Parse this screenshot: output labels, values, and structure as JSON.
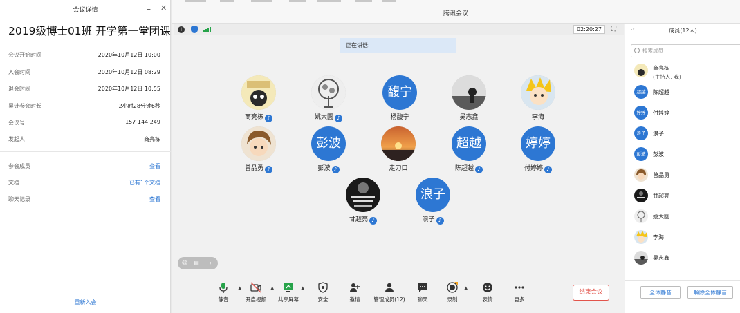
{
  "details": {
    "window_title": "会议详情",
    "meeting_title": "2019级博士01班 开学第一堂团课",
    "rows": [
      {
        "label": "会议开始时间",
        "value": "2020年10月12日 10:00"
      },
      {
        "label": "入会时间",
        "value": "2020年10月12日 08:29"
      },
      {
        "label": "退会时间",
        "value": "2020年10月12日 10:55"
      },
      {
        "label": "累计参会时长",
        "value": "2小时28分钟6秒"
      },
      {
        "label": "会议号",
        "value": "157 144 249"
      },
      {
        "label": "发起人",
        "value": "商亮栋"
      }
    ],
    "link_rows": [
      {
        "label": "参会成员",
        "value": "查看"
      },
      {
        "label": "文档",
        "value": "已有1个文档"
      },
      {
        "label": "聊天记录",
        "value": "查看"
      }
    ],
    "rejoin": "重新入会"
  },
  "meeting": {
    "window_title": "腾讯会议",
    "timer": "02:20:27",
    "speaking_label": "正在讲话:",
    "participants": [
      {
        "name": "商亮栋",
        "avatar": "photo-cartoon",
        "muted_icon": "mic-icon"
      },
      {
        "name": "姚大圆",
        "avatar": "photo-tree",
        "muted_icon": "mic-icon"
      },
      {
        "name": "杨馥宁",
        "avatar_text": "馥宁"
      },
      {
        "name": "吴志鑫",
        "avatar": "photo-dark"
      },
      {
        "name": "李海",
        "avatar": "photo-anime"
      },
      {
        "name": "曾品勇",
        "avatar": "photo-boy",
        "muted_icon": "mic-icon"
      },
      {
        "name": "彭波",
        "avatar_text": "彭波",
        "muted_icon": "mic-icon"
      },
      {
        "name": "走刀口",
        "avatar": "photo-sunset"
      },
      {
        "name": "陈超越",
        "avatar_text": "超越",
        "muted_icon": "mic-icon"
      },
      {
        "name": "付婷婷",
        "avatar_text": "婷婷",
        "muted_icon": "mic-icon"
      },
      {
        "name": "甘超亮",
        "avatar": "photo-poster",
        "muted_icon": "mic-icon"
      },
      {
        "name": "浪子",
        "avatar_text": "浪子",
        "muted_icon": "mic-icon"
      }
    ],
    "toolbar": {
      "mute": "静音",
      "video": "开启视频",
      "share": "共享屏幕",
      "security": "安全",
      "invite": "邀请",
      "manage": "管理成员(12)",
      "chat": "聊天",
      "record": "录制",
      "reactions": "表情",
      "more": "更多",
      "end": "结束会议"
    }
  },
  "members": {
    "title": "成员(12人)",
    "search_placeholder": "搜索成员",
    "list": [
      {
        "name": "商亮栋",
        "sub": "(主持人, 我)",
        "avatar": "photo-cartoon"
      },
      {
        "name": "陈超越",
        "avatar_text": "超越"
      },
      {
        "name": "付婷婷",
        "avatar_text": "婷婷"
      },
      {
        "name": "浪子",
        "avatar_text": "浪子"
      },
      {
        "name": "彭波",
        "avatar_text": "彭波"
      },
      {
        "name": "曾品勇",
        "avatar": "photo-boy"
      },
      {
        "name": "甘超亮",
        "avatar": "photo-poster"
      },
      {
        "name": "姚大圆",
        "avatar": "photo-tree"
      },
      {
        "name": "李海",
        "avatar": "photo-anime"
      },
      {
        "name": "吴志鑫",
        "avatar": "photo-dark"
      }
    ],
    "mute_all": "全体静音",
    "unmute_all": "解除全体静音"
  },
  "colors": {
    "accent": "#2d77d3",
    "end_red": "#e2544b",
    "signal_green": "#27a34a"
  }
}
